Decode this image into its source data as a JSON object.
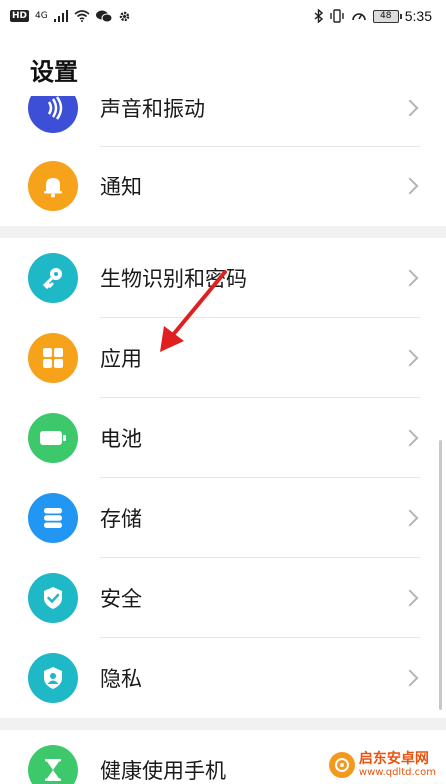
{
  "status_bar": {
    "hd": "HD",
    "network": "4G",
    "battery": "48",
    "time": "5:35",
    "icons": [
      "signal-icon",
      "wifi-icon",
      "wechat-icon",
      "settings-gear-icon",
      "bluetooth-icon",
      "vibrate-icon",
      "speed-icon"
    ]
  },
  "header": {
    "title": "设置"
  },
  "settings_items": [
    {
      "label": "声音和振动",
      "icon": "sound-icon",
      "color": "#3d4fd6"
    },
    {
      "label": "通知",
      "icon": "bell-icon",
      "color": "#f7a21b"
    },
    {
      "label": "生物识别和密码",
      "icon": "key-icon",
      "color": "#1fb8c6"
    },
    {
      "label": "应用",
      "icon": "apps-grid-icon",
      "color": "#f7a21b"
    },
    {
      "label": "电池",
      "icon": "battery-icon",
      "color": "#3dc96b"
    },
    {
      "label": "存储",
      "icon": "storage-icon",
      "color": "#2196f3"
    },
    {
      "label": "安全",
      "icon": "shield-check-icon",
      "color": "#1fb8c6"
    },
    {
      "label": "隐私",
      "icon": "privacy-icon",
      "color": "#1fb8c6"
    },
    {
      "label": "健康使用手机",
      "icon": "hourglass-icon",
      "color": "#3dc96b"
    }
  ],
  "annotation": {
    "color": "#e02020",
    "target": "应用"
  },
  "watermark": {
    "name": "启东安卓网",
    "url": "www.qdltd.com",
    "brand_color": "#e8530e"
  }
}
